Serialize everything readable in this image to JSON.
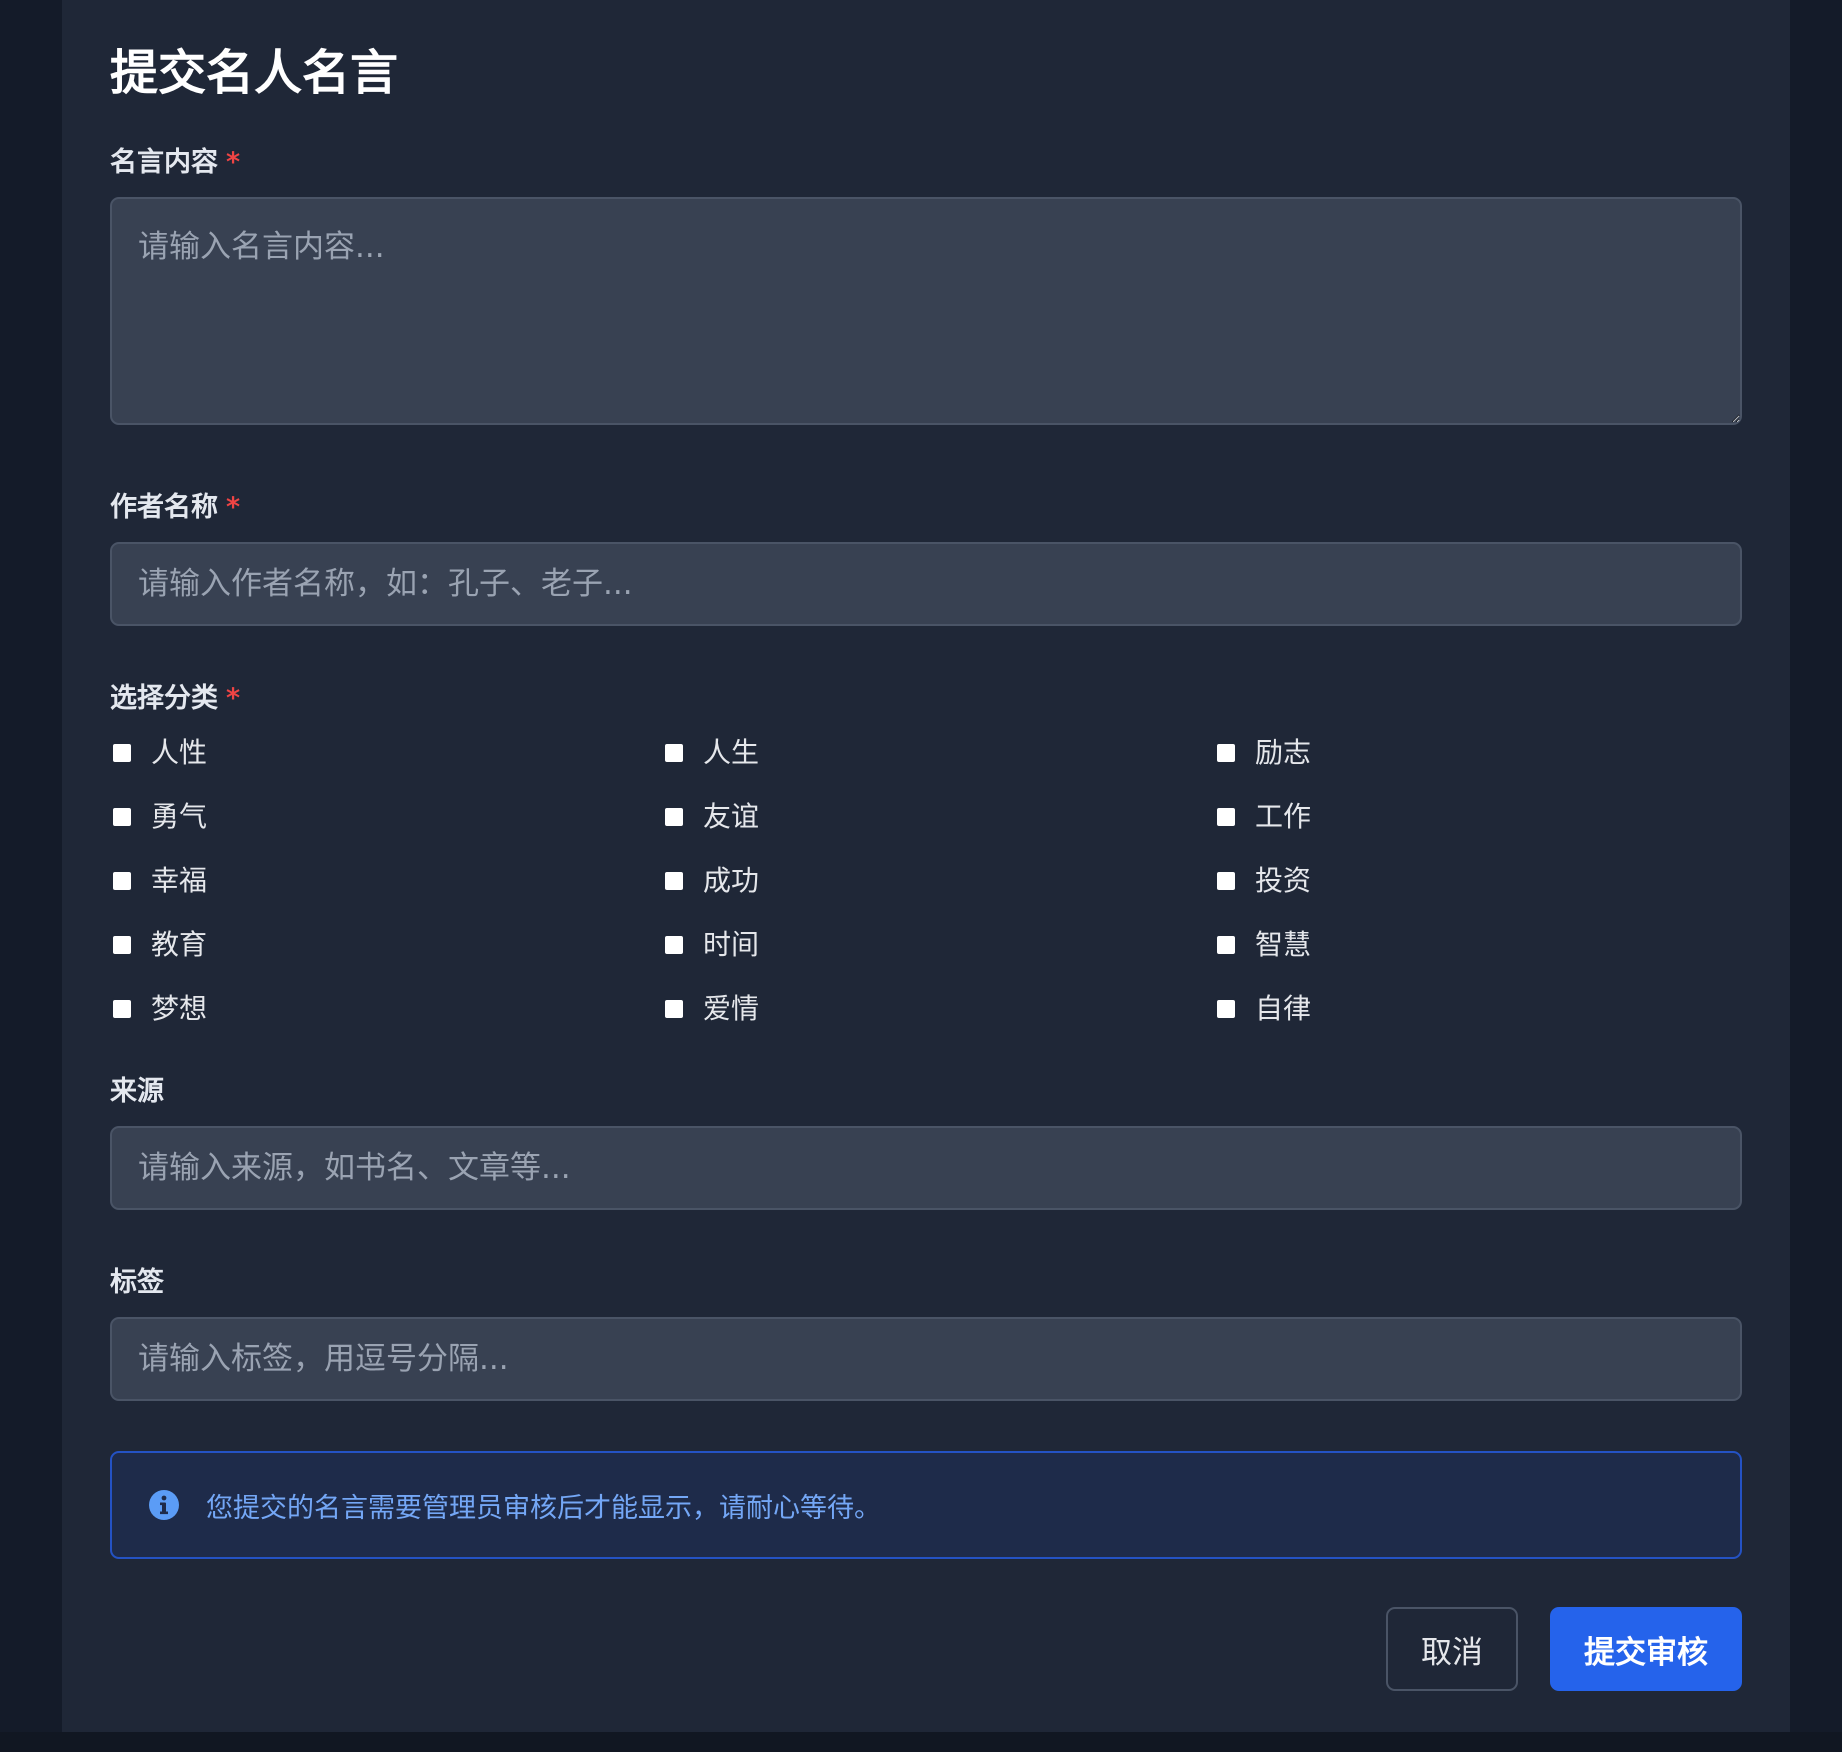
{
  "form": {
    "title": "提交名人名言",
    "required_mark": "*",
    "quote": {
      "label": "名言内容",
      "placeholder": "请输入名言内容...",
      "value": ""
    },
    "author": {
      "label": "作者名称",
      "placeholder": "请输入作者名称，如：孔子、老子...",
      "value": ""
    },
    "categories": {
      "label": "选择分类",
      "items": [
        {
          "label": "人性",
          "checked": false
        },
        {
          "label": "人生",
          "checked": false
        },
        {
          "label": "励志",
          "checked": false
        },
        {
          "label": "勇气",
          "checked": false
        },
        {
          "label": "友谊",
          "checked": false
        },
        {
          "label": "工作",
          "checked": false
        },
        {
          "label": "幸福",
          "checked": false
        },
        {
          "label": "成功",
          "checked": false
        },
        {
          "label": "投资",
          "checked": false
        },
        {
          "label": "教育",
          "checked": false
        },
        {
          "label": "时间",
          "checked": false
        },
        {
          "label": "智慧",
          "checked": false
        },
        {
          "label": "梦想",
          "checked": false
        },
        {
          "label": "爱情",
          "checked": false
        },
        {
          "label": "自律",
          "checked": false
        }
      ]
    },
    "source": {
      "label": "来源",
      "placeholder": "请输入来源，如书名、文章等...",
      "value": ""
    },
    "tags": {
      "label": "标签",
      "placeholder": "请输入标签，用逗号分隔...",
      "value": ""
    },
    "notice": {
      "icon": "info-icon",
      "text": "您提交的名言需要管理员审核后才能显示，请耐心等待。"
    },
    "actions": {
      "cancel_label": "取消",
      "submit_label": "提交审核"
    }
  },
  "colors": {
    "modal_bg": "#1f2737",
    "input_bg": "#384152",
    "accent": "#2563eb",
    "required": "#ef4444",
    "info_text": "#74a7f6",
    "info_border": "#2452c4"
  }
}
